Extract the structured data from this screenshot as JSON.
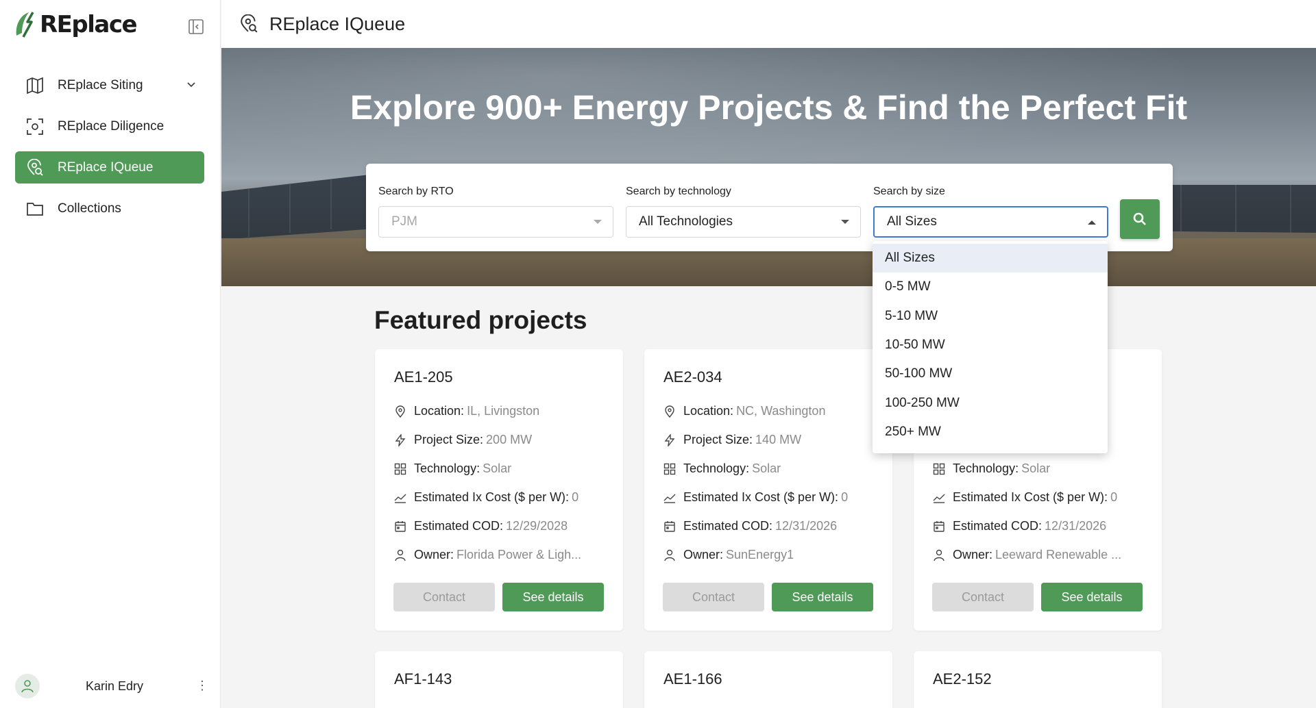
{
  "sidebar": {
    "logo_text": "REplace",
    "items": [
      {
        "label": "REplace Siting",
        "icon": "map-icon",
        "active": false,
        "has_chevron": true
      },
      {
        "label": "REplace Diligence",
        "icon": "scan-icon",
        "active": false
      },
      {
        "label": "REplace IQueue",
        "icon": "location-search-icon",
        "active": true
      },
      {
        "label": "Collections",
        "icon": "folder-icon",
        "active": false
      }
    ],
    "user": {
      "name": "Karin Edry",
      "menu": "⋮"
    }
  },
  "topbar": {
    "title": "REplace IQueue"
  },
  "hero": {
    "title": "Explore 900+ Energy Projects & Find the Perfect Fit"
  },
  "search": {
    "rto": {
      "label": "Search by RTO",
      "value": "PJM"
    },
    "technology": {
      "label": "Search by technology",
      "value": "All Technologies"
    },
    "size": {
      "label": "Search by size",
      "value": "All Sizes",
      "options": [
        "All Sizes",
        "0-5 MW",
        "5-10 MW",
        "10-50 MW",
        "50-100 MW",
        "100-250 MW",
        "250+ MW"
      ]
    }
  },
  "featured": {
    "title": "Featured projects",
    "labels": {
      "location": "Location:",
      "size": "Project Size:",
      "technology": "Technology:",
      "cost": "Estimated Ix Cost ($ per W):",
      "cod": "Estimated COD:",
      "owner": "Owner:",
      "contact": "Contact",
      "details": "See details"
    },
    "projects": [
      {
        "id": "AE1-205",
        "location": "IL, Livingston",
        "size": "200 MW",
        "technology": "Solar",
        "cost": "0",
        "cod": "12/29/2028",
        "owner": "Florida Power & Ligh..."
      },
      {
        "id": "AE2-034",
        "location": "NC, Washington",
        "size": "140 MW",
        "technology": "Solar",
        "cost": "0",
        "cod": "12/31/2026",
        "owner": "SunEnergy1"
      },
      {
        "id": "",
        "location": "",
        "size": "",
        "technology": "Solar",
        "cost": "0",
        "cod": "12/31/2026",
        "owner": "Leeward Renewable ..."
      },
      {
        "id": "AF1-143"
      },
      {
        "id": "AE1-166"
      },
      {
        "id": "AE2-152"
      }
    ]
  },
  "colors": {
    "accent": "#4f9a57",
    "focus": "#3b7bd4"
  }
}
